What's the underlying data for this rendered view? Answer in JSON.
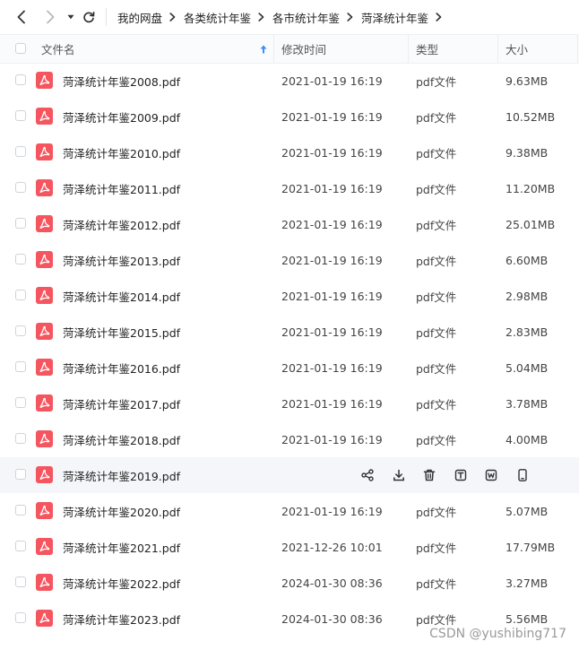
{
  "nav": {
    "back_icon": "chevron-left-icon",
    "forward_icon": "chevron-right-icon",
    "dropdown_icon": "caret-down-icon",
    "refresh_icon": "refresh-icon"
  },
  "breadcrumb": [
    "我的网盘",
    "各类统计年鉴",
    "各市统计年鉴",
    "菏泽统计年鉴"
  ],
  "header": {
    "name": "文件名",
    "modified": "修改时间",
    "type": "类型",
    "size": "大小",
    "sort_icon": "sort-up-arrow-icon"
  },
  "files": [
    {
      "name": "菏泽统计年鉴2008.pdf",
      "modified": "2021-01-19 16:19",
      "type": "pdf文件",
      "size": "9.63MB"
    },
    {
      "name": "菏泽统计年鉴2009.pdf",
      "modified": "2021-01-19 16:19",
      "type": "pdf文件",
      "size": "10.52MB"
    },
    {
      "name": "菏泽统计年鉴2010.pdf",
      "modified": "2021-01-19 16:19",
      "type": "pdf文件",
      "size": "9.38MB"
    },
    {
      "name": "菏泽统计年鉴2011.pdf",
      "modified": "2021-01-19 16:19",
      "type": "pdf文件",
      "size": "11.20MB"
    },
    {
      "name": "菏泽统计年鉴2012.pdf",
      "modified": "2021-01-19 16:19",
      "type": "pdf文件",
      "size": "25.01MB"
    },
    {
      "name": "菏泽统计年鉴2013.pdf",
      "modified": "2021-01-19 16:19",
      "type": "pdf文件",
      "size": "6.60MB"
    },
    {
      "name": "菏泽统计年鉴2014.pdf",
      "modified": "2021-01-19 16:19",
      "type": "pdf文件",
      "size": "2.98MB"
    },
    {
      "name": "菏泽统计年鉴2015.pdf",
      "modified": "2021-01-19 16:19",
      "type": "pdf文件",
      "size": "2.83MB"
    },
    {
      "name": "菏泽统计年鉴2016.pdf",
      "modified": "2021-01-19 16:19",
      "type": "pdf文件",
      "size": "5.04MB"
    },
    {
      "name": "菏泽统计年鉴2017.pdf",
      "modified": "2021-01-19 16:19",
      "type": "pdf文件",
      "size": "3.78MB"
    },
    {
      "name": "菏泽统计年鉴2018.pdf",
      "modified": "2021-01-19 16:19",
      "type": "pdf文件",
      "size": "4.00MB"
    },
    {
      "name": "菏泽统计年鉴2019.pdf",
      "hovered": true,
      "actions": [
        "share-icon",
        "download-icon",
        "delete-icon",
        "text-extract-icon",
        "word-convert-icon",
        "phone-icon"
      ]
    },
    {
      "name": "菏泽统计年鉴2020.pdf",
      "modified": "2021-01-19 16:19",
      "type": "pdf文件",
      "size": "5.07MB"
    },
    {
      "name": "菏泽统计年鉴2021.pdf",
      "modified": "2021-12-26 10:01",
      "type": "pdf文件",
      "size": "17.79MB"
    },
    {
      "name": "菏泽统计年鉴2022.pdf",
      "modified": "2024-01-30 08:36",
      "type": "pdf文件",
      "size": "3.27MB"
    },
    {
      "name": "菏泽统计年鉴2023.pdf",
      "modified": "2024-01-30 08:36",
      "type": "pdf文件",
      "size": "5.56MB"
    }
  ],
  "colors": {
    "pdf_icon": "#f4555f",
    "sort_arrow": "#3b8cff",
    "hover_row": "#f4f6f9"
  },
  "watermark": "CSDN @yushibing717"
}
